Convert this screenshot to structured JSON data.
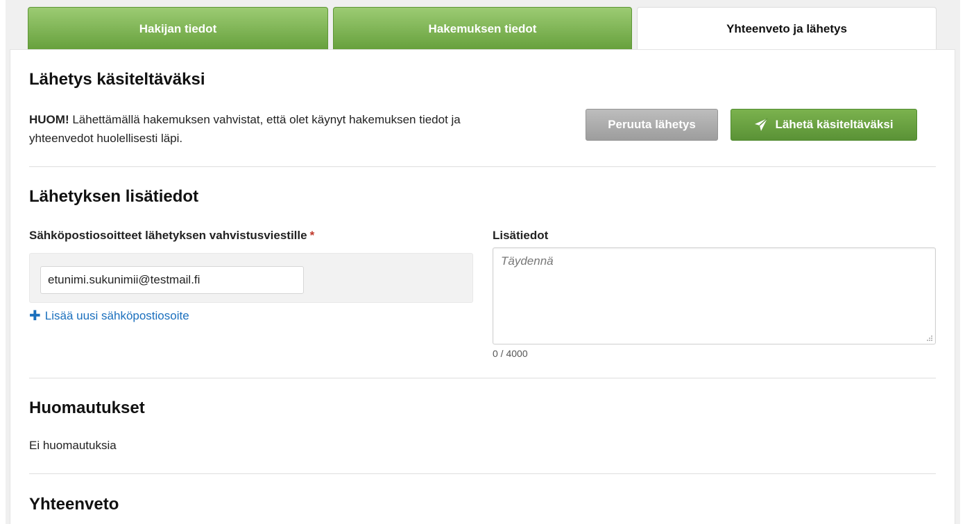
{
  "tabs": [
    {
      "label": "Hakijan tiedot"
    },
    {
      "label": "Hakemuksen tiedot"
    },
    {
      "label": "Yhteenveto ja lähetys"
    }
  ],
  "submit_section": {
    "title": "Lähetys käsiteltäväksi",
    "notice_bold": "HUOM!",
    "notice_text": " Lähettämällä hakemuksen vahvistat, että olet käynyt hakemuksen tiedot ja yhteenvedot huolellisesti läpi.",
    "cancel_label": "Peruuta lähetys",
    "send_label": "Lähetä käsiteltäväksi"
  },
  "extra_info": {
    "title": "Lähetyksen lisätiedot",
    "email_label": "Sähköpostiosoitteet lähetyksen vahvistusviestille",
    "required_mark": "*",
    "email_value": "etunimi.sukunimii@testmail.fi",
    "add_email_label": "Lisää uusi sähköpostiosoite",
    "notes_label": "Lisätiedot",
    "notes_placeholder": "Täydennä",
    "notes_value": "",
    "char_counter": "0 / 4000"
  },
  "remarks": {
    "title": "Huomautukset",
    "text": "Ei huomautuksia"
  },
  "summary": {
    "title": "Yhteenveto"
  },
  "colors": {
    "tab_green": "#77ad4b",
    "button_green": "#6aa33f",
    "button_gray": "#acacac",
    "link_blue": "#1a6fbd",
    "required_red": "#c0392b"
  },
  "icons": {
    "send": "paper-plane-icon",
    "add": "plus-icon"
  }
}
